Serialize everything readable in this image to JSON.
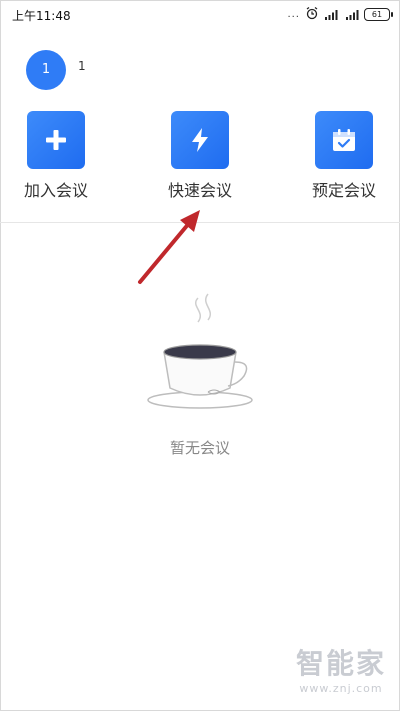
{
  "status_bar": {
    "time": "上午11:48",
    "dots": "...",
    "battery": "61"
  },
  "user": {
    "avatar_text": "1",
    "name": "1"
  },
  "actions": [
    {
      "label": "加入会议",
      "icon": "plus-icon"
    },
    {
      "label": "快速会议",
      "icon": "lightning-icon"
    },
    {
      "label": "预定会议",
      "icon": "calendar-check-icon"
    }
  ],
  "empty_state": {
    "message": "暂无会议",
    "illustration": "coffee-cup-icon"
  },
  "watermark": {
    "title": "智能家",
    "url": "www.znj.com"
  },
  "colors": {
    "accent": "#2f7cf6",
    "annotation": "#c0282c"
  }
}
